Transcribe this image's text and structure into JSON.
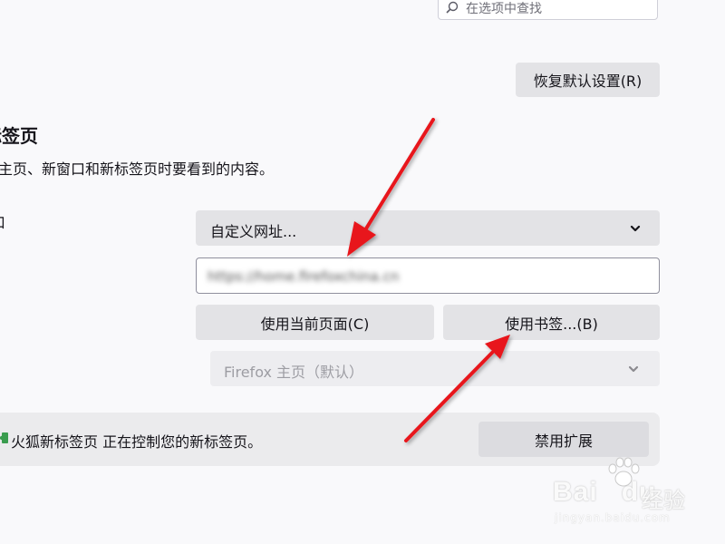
{
  "search": {
    "placeholder": "在选项中查找"
  },
  "header": {
    "restore_defaults_label": "恢复默认设置(R)"
  },
  "section": {
    "title": "标签页",
    "description": "主页、新窗口和新标签页时要看到的内容。",
    "row_label": "口"
  },
  "homepage": {
    "select_value": "自定义网址...",
    "url_value": "https://home.firefoxchina.cn",
    "use_current_label": "使用当前页面(C)",
    "use_bookmark_label": "使用书签...(B)"
  },
  "newtab": {
    "select_value": "Firefox 主页（默认）"
  },
  "extension": {
    "message": "火狐新标签页 正在控制您的新标签页。",
    "disable_label": "禁用扩展"
  },
  "watermark": {
    "brand": "Bai",
    "brand_suffix": "du",
    "cn": "经验",
    "url": "jingyan.baidu.com"
  },
  "colors": {
    "arrow": "#e8191c",
    "button_bg": "#e3e3e6",
    "page_bg": "#f9f9fb"
  },
  "icons": {
    "search": "search-icon",
    "chevron": "chevron-down-icon",
    "extension": "puzzle-icon",
    "paw": "paw-icon"
  }
}
